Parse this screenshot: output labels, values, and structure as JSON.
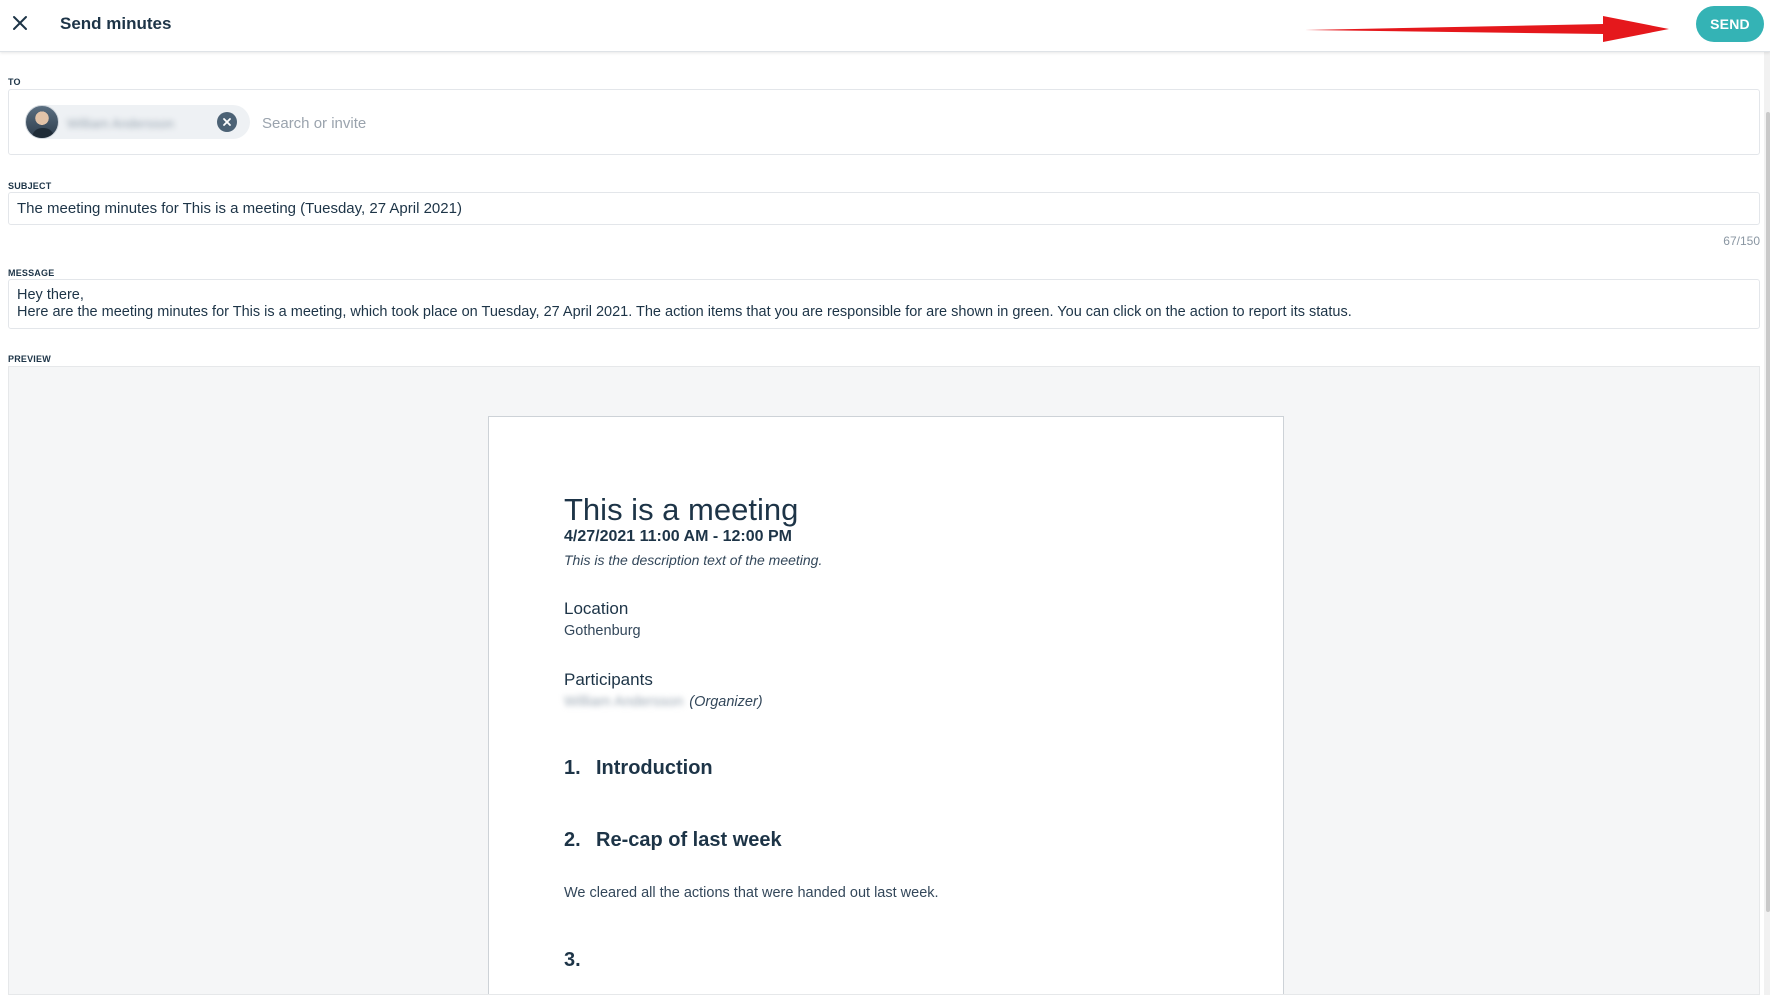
{
  "header": {
    "title": "Send minutes",
    "send_label": "SEND",
    "arrow_color": "#e5181c",
    "accent": "#34b3b5"
  },
  "to": {
    "label": "TO",
    "recipient_name": "William Andersson",
    "placeholder": "Search or invite"
  },
  "subject": {
    "label": "SUBJECT",
    "value": "The meeting minutes for This is a meeting (Tuesday, 27 April 2021)",
    "counter": "67/150"
  },
  "message": {
    "label": "MESSAGE",
    "line1": "Hey there,",
    "line2": "Here are the meeting minutes for This is a meeting, which took place on Tuesday, 27 April 2021. The action items that you are responsible for are shown in green. You can click on the action to report its status."
  },
  "preview": {
    "label": "PREVIEW",
    "meeting_title": "This is a meeting",
    "datetime": "4/27/2021 11:00 AM - 12:00 PM",
    "description": "This is the description text of the meeting.",
    "location_heading": "Location",
    "location_value": "Gothenburg",
    "participants_heading": "Participants",
    "participant_name": "William Andersson",
    "participant_role": "(Organizer)",
    "agenda": [
      {
        "num": "1.",
        "title": "Introduction",
        "text": ""
      },
      {
        "num": "2.",
        "title": "Re-cap of last week",
        "text": "We cleared all the actions that were handed out last week."
      },
      {
        "num": "3.",
        "title": "",
        "text": ""
      }
    ]
  }
}
